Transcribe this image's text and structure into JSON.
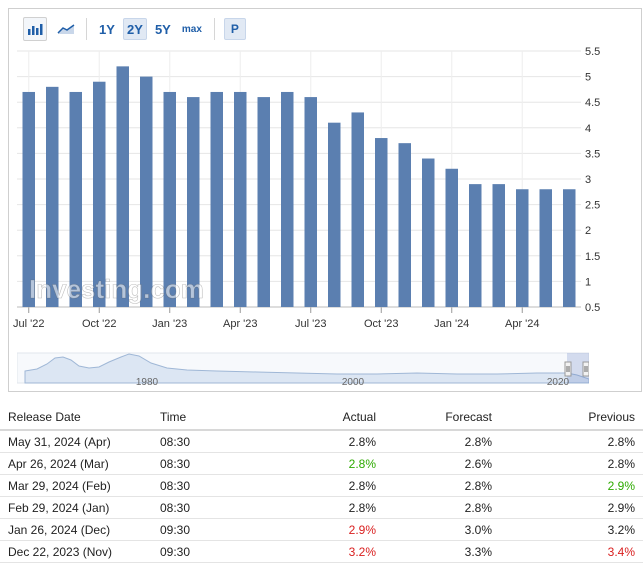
{
  "toolbar": {
    "icons": [
      "bar-chart-icon",
      "area-chart-icon"
    ],
    "ranges": [
      {
        "label": "1Y",
        "active": false
      },
      {
        "label": "2Y",
        "active": true
      },
      {
        "label": "5Y",
        "active": false
      },
      {
        "label": "max",
        "active": false
      }
    ],
    "p_label": "P"
  },
  "chart_data": {
    "type": "bar",
    "title": "",
    "color": "#5b7fb0",
    "values": [
      4.7,
      4.8,
      4.7,
      4.9,
      5.2,
      5.0,
      4.7,
      4.6,
      4.7,
      4.7,
      4.6,
      4.7,
      4.6,
      4.1,
      4.3,
      3.8,
      3.7,
      3.4,
      3.2,
      2.9,
      2.9,
      2.8,
      2.8,
      2.8
    ],
    "x_tick_labels": [
      "Jul '22",
      "Oct '22",
      "Jan '23",
      "Apr '23",
      "Jul '23",
      "Oct '23",
      "Jan '24",
      "Apr '24"
    ],
    "x_tick_bar_index": [
      0,
      3,
      6,
      9,
      12,
      15,
      18,
      21
    ],
    "y_ticks": [
      "5.5",
      "5",
      "4.5",
      "4",
      "3.5",
      "3",
      "2.5",
      "2",
      "1.5",
      "1",
      "0.5"
    ],
    "ylim": [
      0.5,
      5.5
    ],
    "grid": true,
    "watermark": "Investing.com"
  },
  "navigator": {
    "labels": [
      "1980",
      "2000",
      "2020"
    ]
  },
  "table": {
    "headers": {
      "release_date": "Release Date",
      "time": "Time",
      "actual": "Actual",
      "forecast": "Forecast",
      "previous": "Previous"
    },
    "rows": [
      {
        "date": "May 31, 2024 (Apr)",
        "time": "08:30",
        "actual": "2.8%",
        "actual_status": "neutral",
        "forecast": "2.8%",
        "previous": "2.8%",
        "previous_status": "neutral"
      },
      {
        "date": "Apr 26, 2024 (Mar)",
        "time": "08:30",
        "actual": "2.8%",
        "actual_status": "up",
        "forecast": "2.6%",
        "previous": "2.8%",
        "previous_status": "neutral"
      },
      {
        "date": "Mar 29, 2024 (Feb)",
        "time": "08:30",
        "actual": "2.8%",
        "actual_status": "neutral",
        "forecast": "2.8%",
        "previous": "2.9%",
        "previous_status": "up"
      },
      {
        "date": "Feb 29, 2024 (Jan)",
        "time": "08:30",
        "actual": "2.8%",
        "actual_status": "neutral",
        "forecast": "2.8%",
        "previous": "2.9%",
        "previous_status": "neutral"
      },
      {
        "date": "Jan 26, 2024 (Dec)",
        "time": "09:30",
        "actual": "2.9%",
        "actual_status": "down",
        "forecast": "3.0%",
        "previous": "3.2%",
        "previous_status": "neutral"
      },
      {
        "date": "Dec 22, 2023 (Nov)",
        "time": "09:30",
        "actual": "3.2%",
        "actual_status": "down",
        "forecast": "3.3%",
        "previous": "3.4%",
        "previous_status": "down"
      }
    ]
  }
}
